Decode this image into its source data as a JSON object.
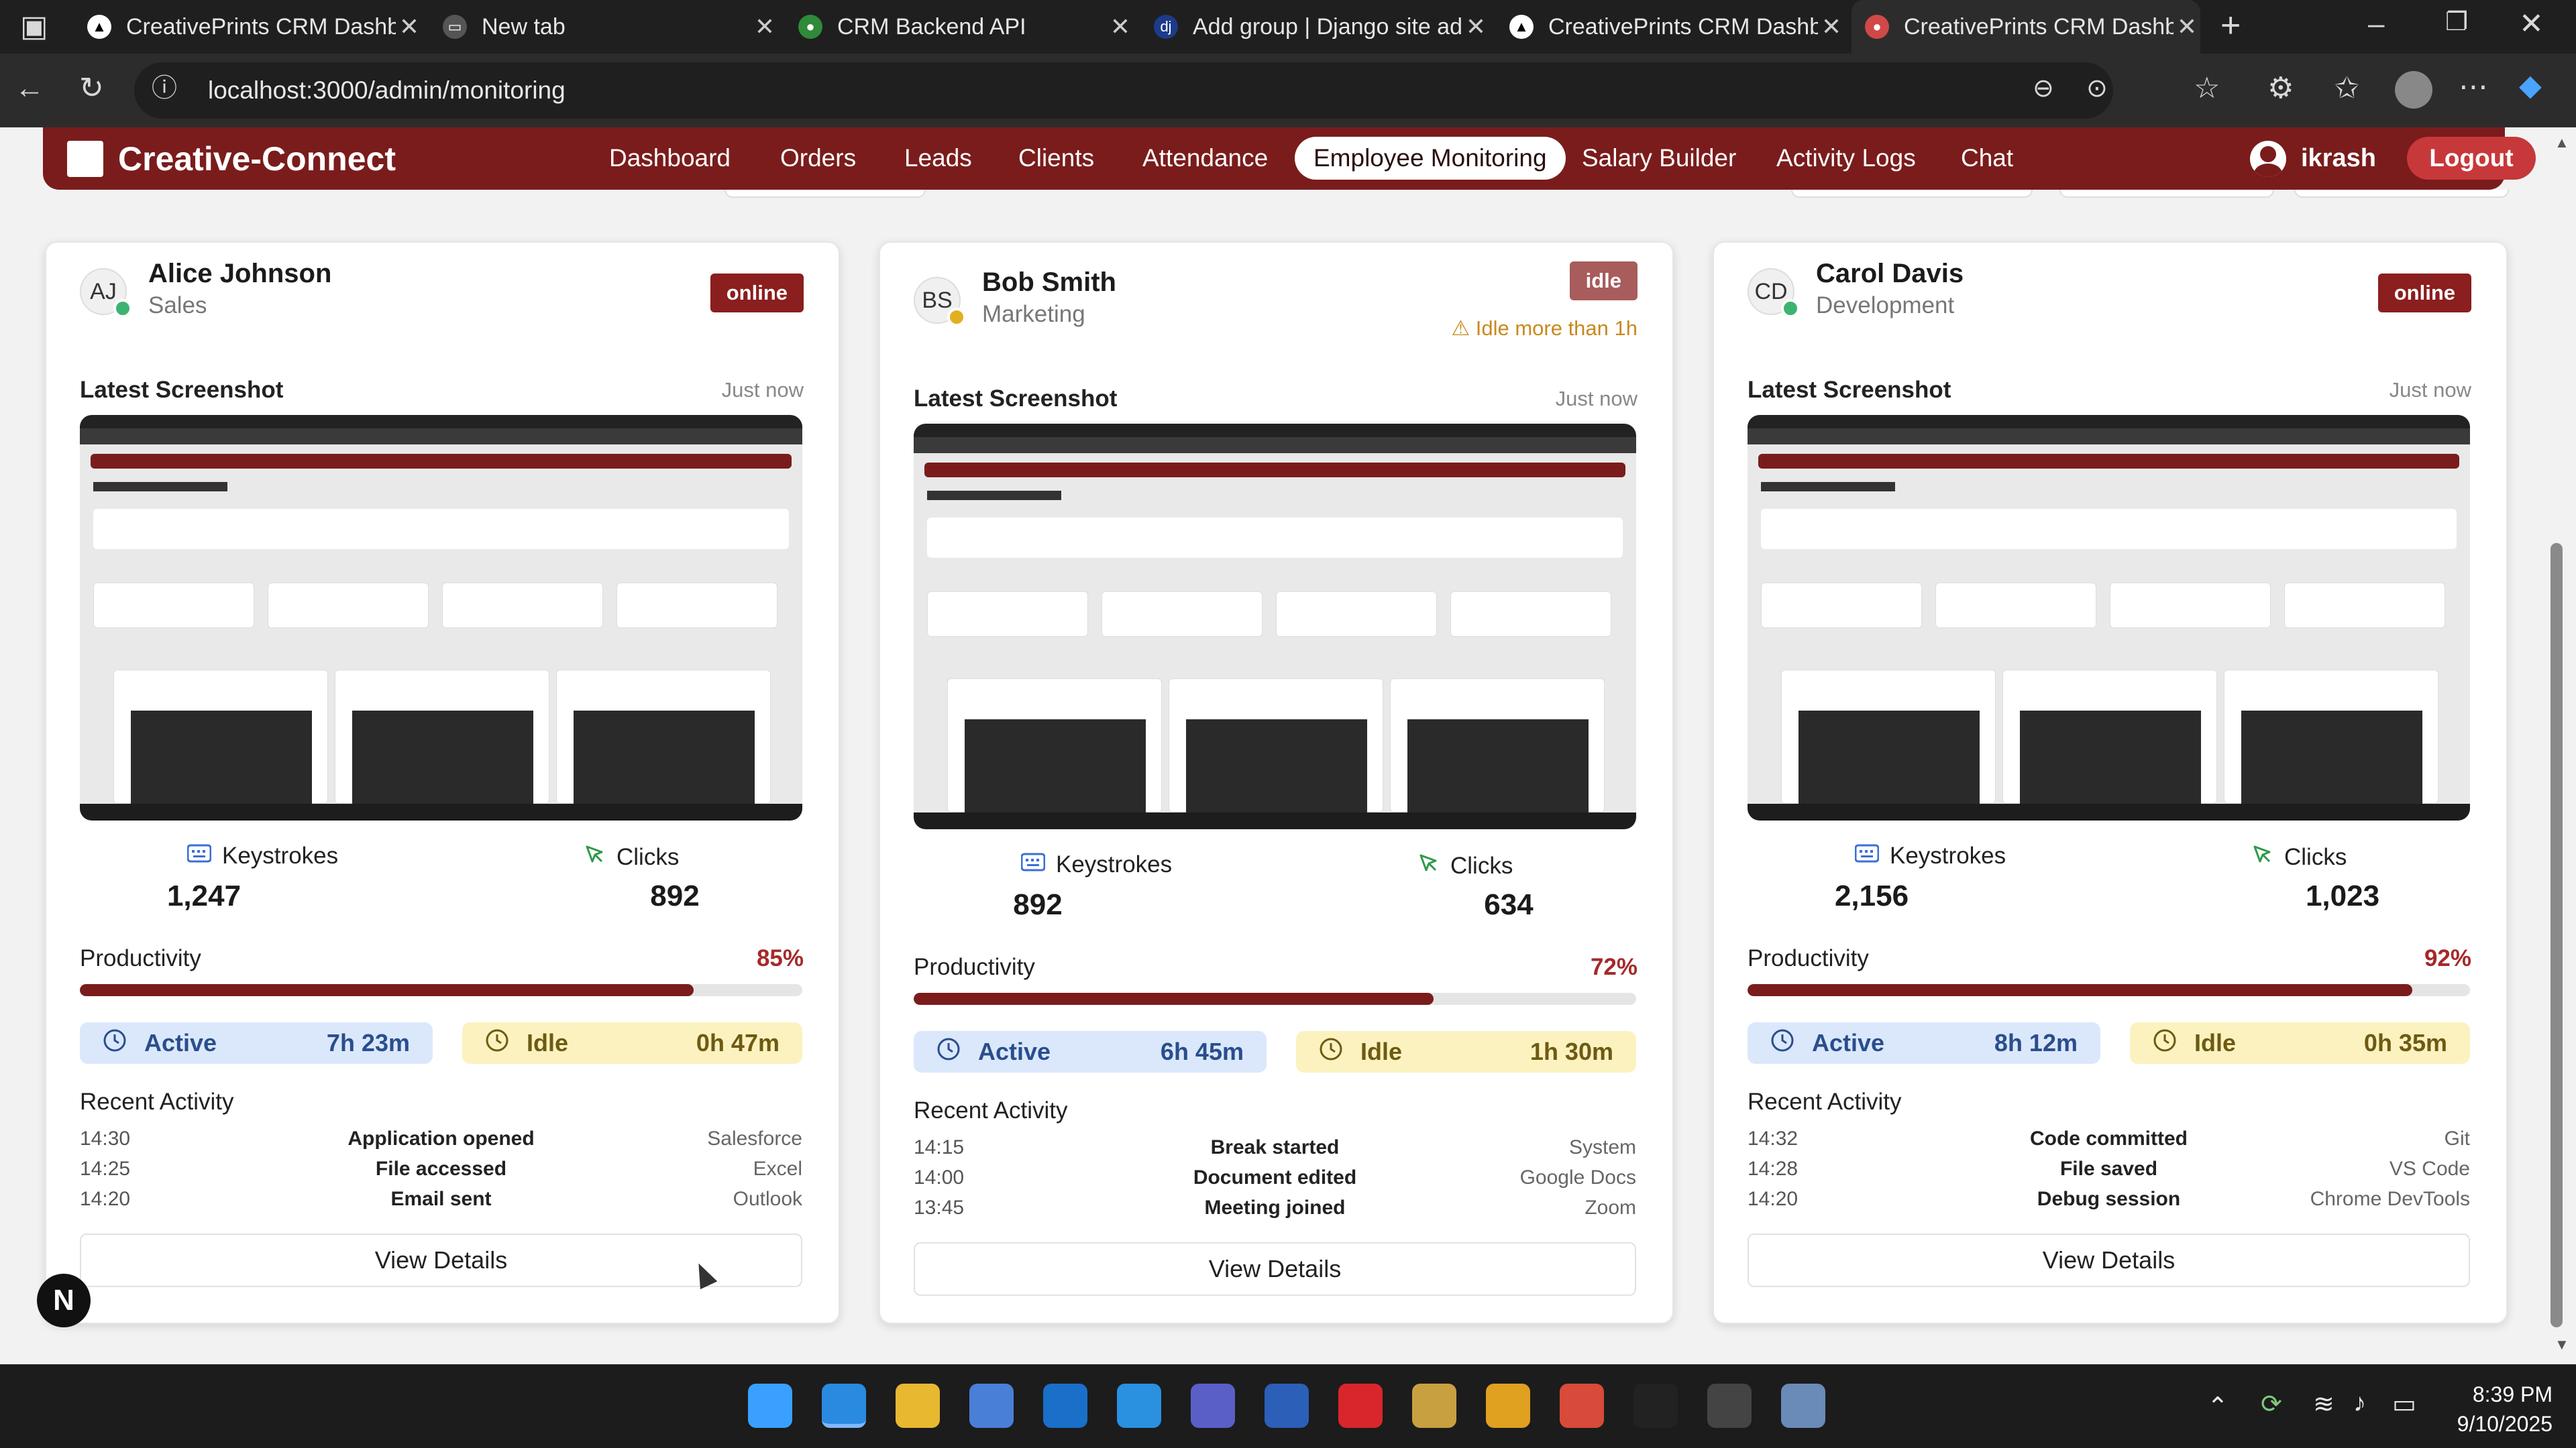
{
  "browser": {
    "tabs": [
      {
        "title": "CreativePrints CRM Dashboard",
        "color": "#ffffff",
        "fav": "▲"
      },
      {
        "title": "New tab",
        "color": "#555555",
        "fav": "▭"
      },
      {
        "title": "CRM Backend API",
        "color": "#2f8a3a",
        "fav": "●"
      },
      {
        "title": "Add group | Django site admin",
        "color": "#1d3b8a",
        "fav": "dj"
      },
      {
        "title": "CreativePrints CRM Dashboard",
        "color": "#ffffff",
        "fav": "▲"
      },
      {
        "title": "CreativePrints CRM Dashboard",
        "color": "#d04848",
        "fav": "●"
      }
    ],
    "url": "localhost:3000/admin/monitoring"
  },
  "nav": {
    "brand": "Creative-Connect",
    "links": [
      "Dashboard",
      "Orders",
      "Leads",
      "Clients",
      "Attendance",
      "Employee Monitoring",
      "Salary Builder",
      "Activity Logs",
      "Chat"
    ],
    "active": "Employee Monitoring",
    "user": "ikrash",
    "logout": "Logout"
  },
  "labels": {
    "latest_screenshot": "Latest Screenshot",
    "keystrokes": "Keystrokes",
    "clicks": "Clicks",
    "productivity": "Productivity",
    "active": "Active",
    "idle": "Idle",
    "recent_activity": "Recent Activity",
    "view_details": "View Details"
  },
  "employees": [
    {
      "initials": "AJ",
      "name": "Alice Johnson",
      "department": "Sales",
      "status": "online",
      "status_color": "#8b1e1e",
      "dot_color": "#3cb371",
      "warning": "",
      "screenshot_time": "Just now",
      "keystrokes": "1,247",
      "clicks": "892",
      "productivity_label": "85%",
      "productivity": 0.85,
      "active": "7h 23m",
      "idle": "0h 47m",
      "activity": [
        {
          "time": "14:30",
          "action": "Application opened",
          "source": "Salesforce"
        },
        {
          "time": "14:25",
          "action": "File accessed",
          "source": "Excel"
        },
        {
          "time": "14:20",
          "action": "Email sent",
          "source": "Outlook"
        }
      ]
    },
    {
      "initials": "BS",
      "name": "Bob Smith",
      "department": "Marketing",
      "status": "idle",
      "status_color": "#a85c5c",
      "dot_color": "#e0b020",
      "warning": "Idle more than 1h",
      "screenshot_time": "Just now",
      "keystrokes": "892",
      "clicks": "634",
      "productivity_label": "72%",
      "productivity": 0.72,
      "active": "6h 45m",
      "idle": "1h 30m",
      "activity": [
        {
          "time": "14:15",
          "action": "Break started",
          "source": "System"
        },
        {
          "time": "14:00",
          "action": "Document edited",
          "source": "Google Docs"
        },
        {
          "time": "13:45",
          "action": "Meeting joined",
          "source": "Zoom"
        }
      ]
    },
    {
      "initials": "CD",
      "name": "Carol Davis",
      "department": "Development",
      "status": "online",
      "status_color": "#8b1e1e",
      "dot_color": "#3cb371",
      "warning": "",
      "screenshot_time": "Just now",
      "keystrokes": "2,156",
      "clicks": "1,023",
      "productivity_label": "92%",
      "productivity": 0.92,
      "active": "8h 12m",
      "idle": "0h 35m",
      "activity": [
        {
          "time": "14:32",
          "action": "Code committed",
          "source": "Git"
        },
        {
          "time": "14:28",
          "action": "File saved",
          "source": "VS Code"
        },
        {
          "time": "14:20",
          "action": "Debug session",
          "source": "Chrome DevTools"
        }
      ]
    }
  ],
  "overlay_badge": "N",
  "taskbar": {
    "apps": [
      "windows-start",
      "edge",
      "file-explorer",
      "microsoft-store",
      "outlook",
      "vs-code",
      "teams",
      "word",
      "wps-office",
      "archive",
      "chrome",
      "chrome-profile",
      "epic-games",
      "terminal",
      "task-app"
    ],
    "time": "8:39 PM",
    "date": "9/10/2025"
  }
}
